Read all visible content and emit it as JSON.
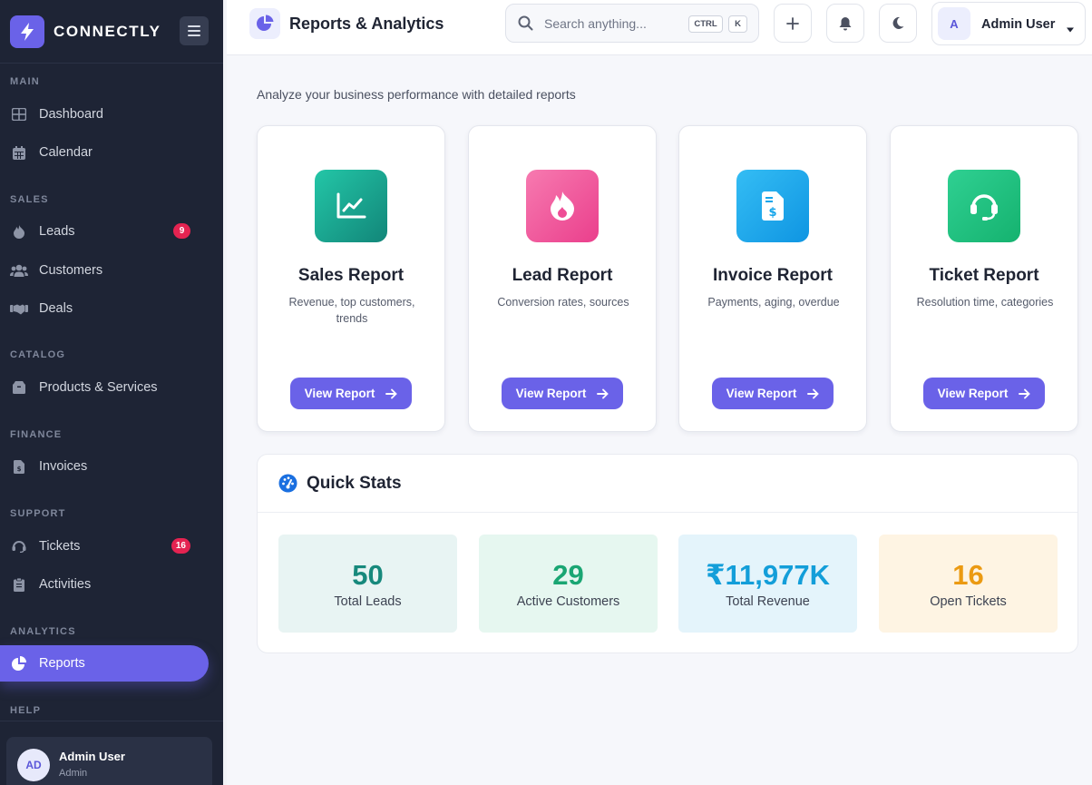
{
  "sidebar": {
    "brand": "CONNECTLY",
    "sections": {
      "main": "MAIN",
      "sales": "SALES",
      "catalog": "CATALOG",
      "finance": "FINANCE",
      "support": "SUPPORT",
      "analytics": "ANALYTICS",
      "help": "HELP"
    },
    "items": {
      "dashboard": "Dashboard",
      "calendar": "Calendar",
      "leads": "Leads",
      "customers": "Customers",
      "deals": "Deals",
      "products": "Products & Services",
      "invoices": "Invoices",
      "tickets": "Tickets",
      "activities": "Activities",
      "reports": "Reports"
    },
    "badges": {
      "leads": "9",
      "tickets": "16"
    },
    "user": {
      "initials": "AD",
      "name": "Admin User",
      "role": "Admin"
    }
  },
  "topbar": {
    "title": "Reports & Analytics",
    "search_placeholder": "Search anything...",
    "shortcut_ctrl": "CTRL",
    "shortcut_key": "K",
    "user_initial": "A",
    "user_name": "Admin User"
  },
  "main": {
    "subtitle": "Analyze your business performance with detailed reports",
    "reports": [
      {
        "title": "Sales Report",
        "desc": "Revenue, top customers, trends",
        "button": "View Report",
        "icon": "chart-line-icon",
        "color": "#17a393"
      },
      {
        "title": "Lead Report",
        "desc": "Conversion rates, sources",
        "button": "View Report",
        "icon": "fire-icon",
        "color": "#ee4d96"
      },
      {
        "title": "Invoice Report",
        "desc": "Payments, aging, overdue",
        "button": "View Report",
        "icon": "invoice-dollar-icon",
        "color": "#16a5ea"
      },
      {
        "title": "Ticket Report",
        "desc": "Resolution time, categories",
        "button": "View Report",
        "icon": "headset-icon",
        "color": "#1cc07e"
      }
    ],
    "quick_stats": {
      "title": "Quick Stats",
      "items": [
        {
          "value": "50",
          "label": "Total Leads",
          "color": "#17897c",
          "bg": "#e8f4f3"
        },
        {
          "value": "29",
          "label": "Active Customers",
          "color": "#1aa673",
          "bg": "#e6f7f0"
        },
        {
          "value": "₹11,977K",
          "label": "Total Revenue",
          "color": "#139ed9",
          "bg": "#e4f4fb"
        },
        {
          "value": "16",
          "label": "Open Tickets",
          "color": "#eb9a12",
          "bg": "#fef4e3"
        }
      ]
    }
  },
  "colors": {
    "accent": "#6a62e8",
    "sidebar_bg": "#1e2435",
    "badge": "#e42351"
  }
}
